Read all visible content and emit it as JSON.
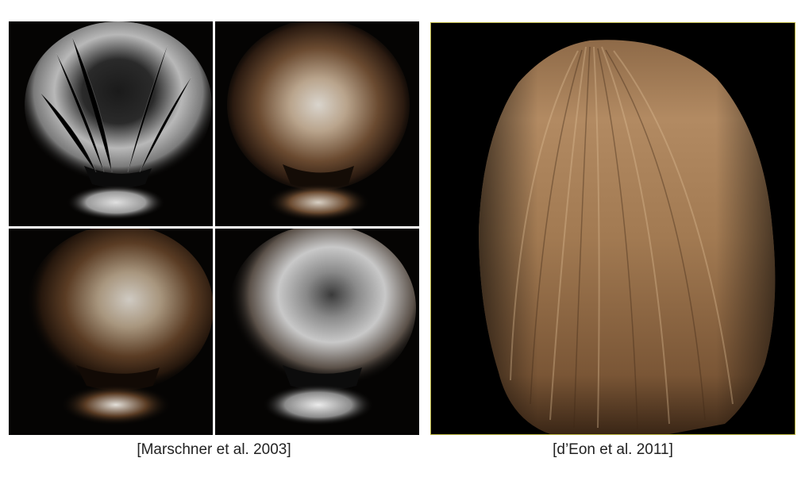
{
  "figure": {
    "left_group": {
      "caption": "[Marschner et al. 2003]",
      "panels": [
        {
          "id": "top-left",
          "highlight": "white"
        },
        {
          "id": "top-right",
          "highlight": "brown"
        },
        {
          "id": "bottom-left",
          "highlight": "brown"
        },
        {
          "id": "bottom-right",
          "highlight": "white"
        }
      ]
    },
    "right_group": {
      "caption": "[d’Eon et al. 2011]",
      "hair_color": "#a27a52"
    },
    "colors": {
      "background": "#ffffff",
      "panel_background": "#050403",
      "right_border": "#b9b23c",
      "caption_text": "#222222"
    }
  }
}
